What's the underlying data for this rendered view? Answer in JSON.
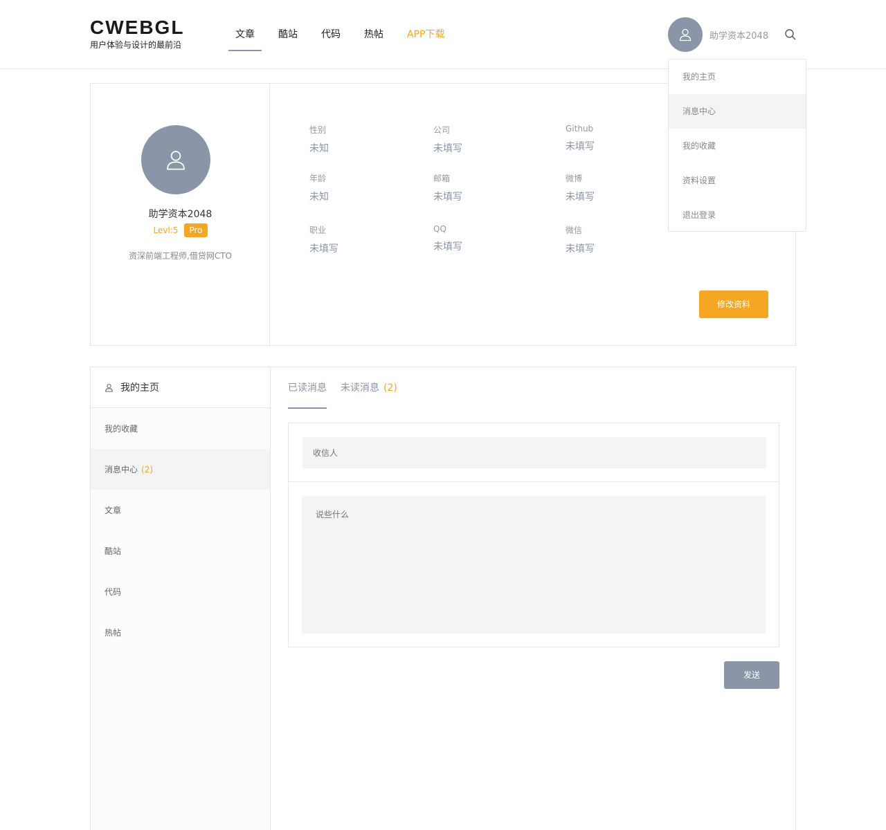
{
  "header": {
    "logo_title": "CWEBGL",
    "logo_subtitle": "用户体验与设计的最前沿",
    "nav": [
      "文章",
      "酷站",
      "代码",
      "热帖",
      "APP下载"
    ],
    "username": "助学资本2048"
  },
  "dropdown": [
    "我的主页",
    "消息中心",
    "我的收藏",
    "资料设置",
    "退出登录"
  ],
  "profile": {
    "name": "助学资本2048",
    "level": "Levl:5",
    "badge": "Pro",
    "description": "资深前端工程师,借贷网CTO",
    "fields": [
      {
        "label": "性别",
        "value": "未知"
      },
      {
        "label": "公司",
        "value": "未填写"
      },
      {
        "label": "Github",
        "value": "未填写"
      },
      {
        "label": "年龄",
        "value": "未知"
      },
      {
        "label": "邮箱",
        "value": "未填写"
      },
      {
        "label": "微博",
        "value": "未填写"
      },
      {
        "label": "职业",
        "value": "未填写"
      },
      {
        "label": "QQ",
        "value": "未填写"
      },
      {
        "label": "微信",
        "value": "未填写"
      }
    ],
    "edit_button": "修改资料"
  },
  "sidebar": {
    "title": "我的主页",
    "items": [
      {
        "label": "我的收藏",
        "count": ""
      },
      {
        "label": "消息中心",
        "count": "(2)"
      },
      {
        "label": "文章",
        "count": ""
      },
      {
        "label": "酷站",
        "count": ""
      },
      {
        "label": "代码",
        "count": ""
      },
      {
        "label": "热帖",
        "count": ""
      }
    ]
  },
  "messages": {
    "tabs": [
      {
        "label": "已读消息",
        "count": ""
      },
      {
        "label": "未读消息",
        "count": "(2)"
      }
    ],
    "recipient_placeholder": "收信人",
    "message_placeholder": "说些什么",
    "send_button": "发送"
  },
  "colors": {
    "accent": "#f5a623",
    "primary": "#8a95a8",
    "field_bg": "#f3f4f6",
    "border": "#e6e6e6"
  }
}
